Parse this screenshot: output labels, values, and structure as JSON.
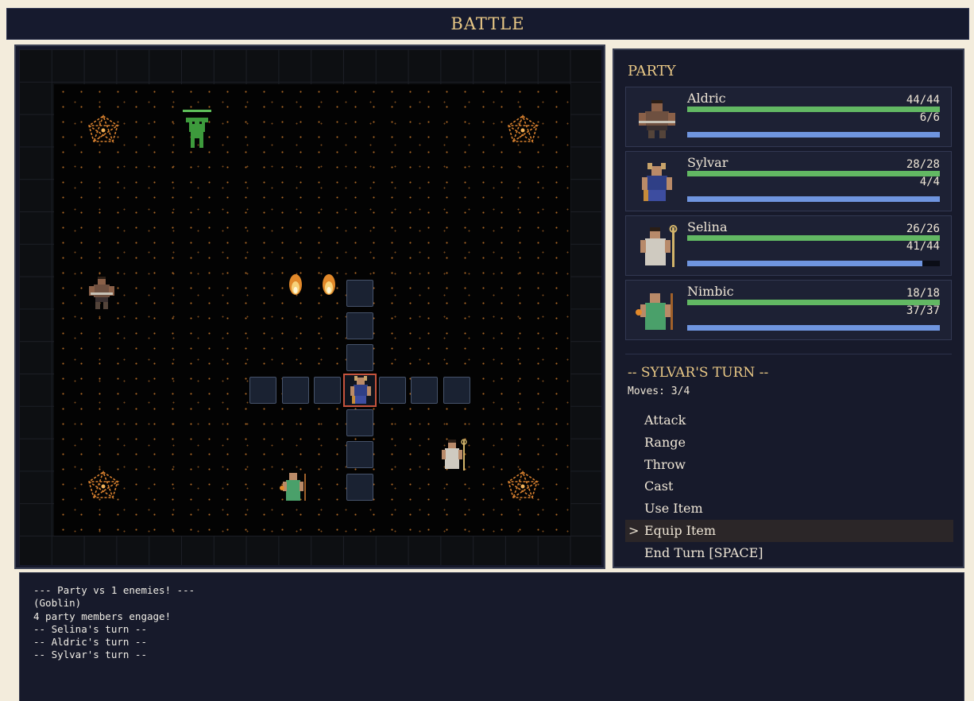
{
  "header": {
    "title": "BATTLE"
  },
  "party": {
    "title": "PARTY",
    "members": [
      {
        "name": "Aldric",
        "hp": "44/44",
        "mp": "6/6",
        "hp_fraction": 1.0,
        "mp_fraction": 1.0
      },
      {
        "name": "Sylvar",
        "hp": "28/28",
        "mp": "4/4",
        "hp_fraction": 1.0,
        "mp_fraction": 1.0
      },
      {
        "name": "Selina",
        "hp": "26/26",
        "mp": "41/44",
        "hp_fraction": 1.0,
        "mp_fraction": 0.932
      },
      {
        "name": "Nimbic",
        "hp": "18/18",
        "mp": "37/37",
        "hp_fraction": 1.0,
        "mp_fraction": 1.0
      }
    ]
  },
  "turn": {
    "title": "-- SYLVAR'S TURN --",
    "moves": "Moves: 3/4"
  },
  "menu": {
    "cursor": ">",
    "items": [
      "Attack",
      "Range",
      "Throw",
      "Cast",
      "Use Item",
      "Equip Item",
      "End Turn [SPACE]"
    ],
    "selected_index": 5
  },
  "log": {
    "lines": [
      "--- Party vs 1 enemies! ---",
      "(Goblin)",
      "4 party members engage!",
      "-- Selina's turn --",
      "-- Aldric's turn --",
      "-- Sylvar's turn --"
    ]
  },
  "colors": {
    "accent": "#e9c886",
    "hp_bar": "#62b863",
    "mp_bar": "#6f95df",
    "selection": "#c5533d"
  }
}
